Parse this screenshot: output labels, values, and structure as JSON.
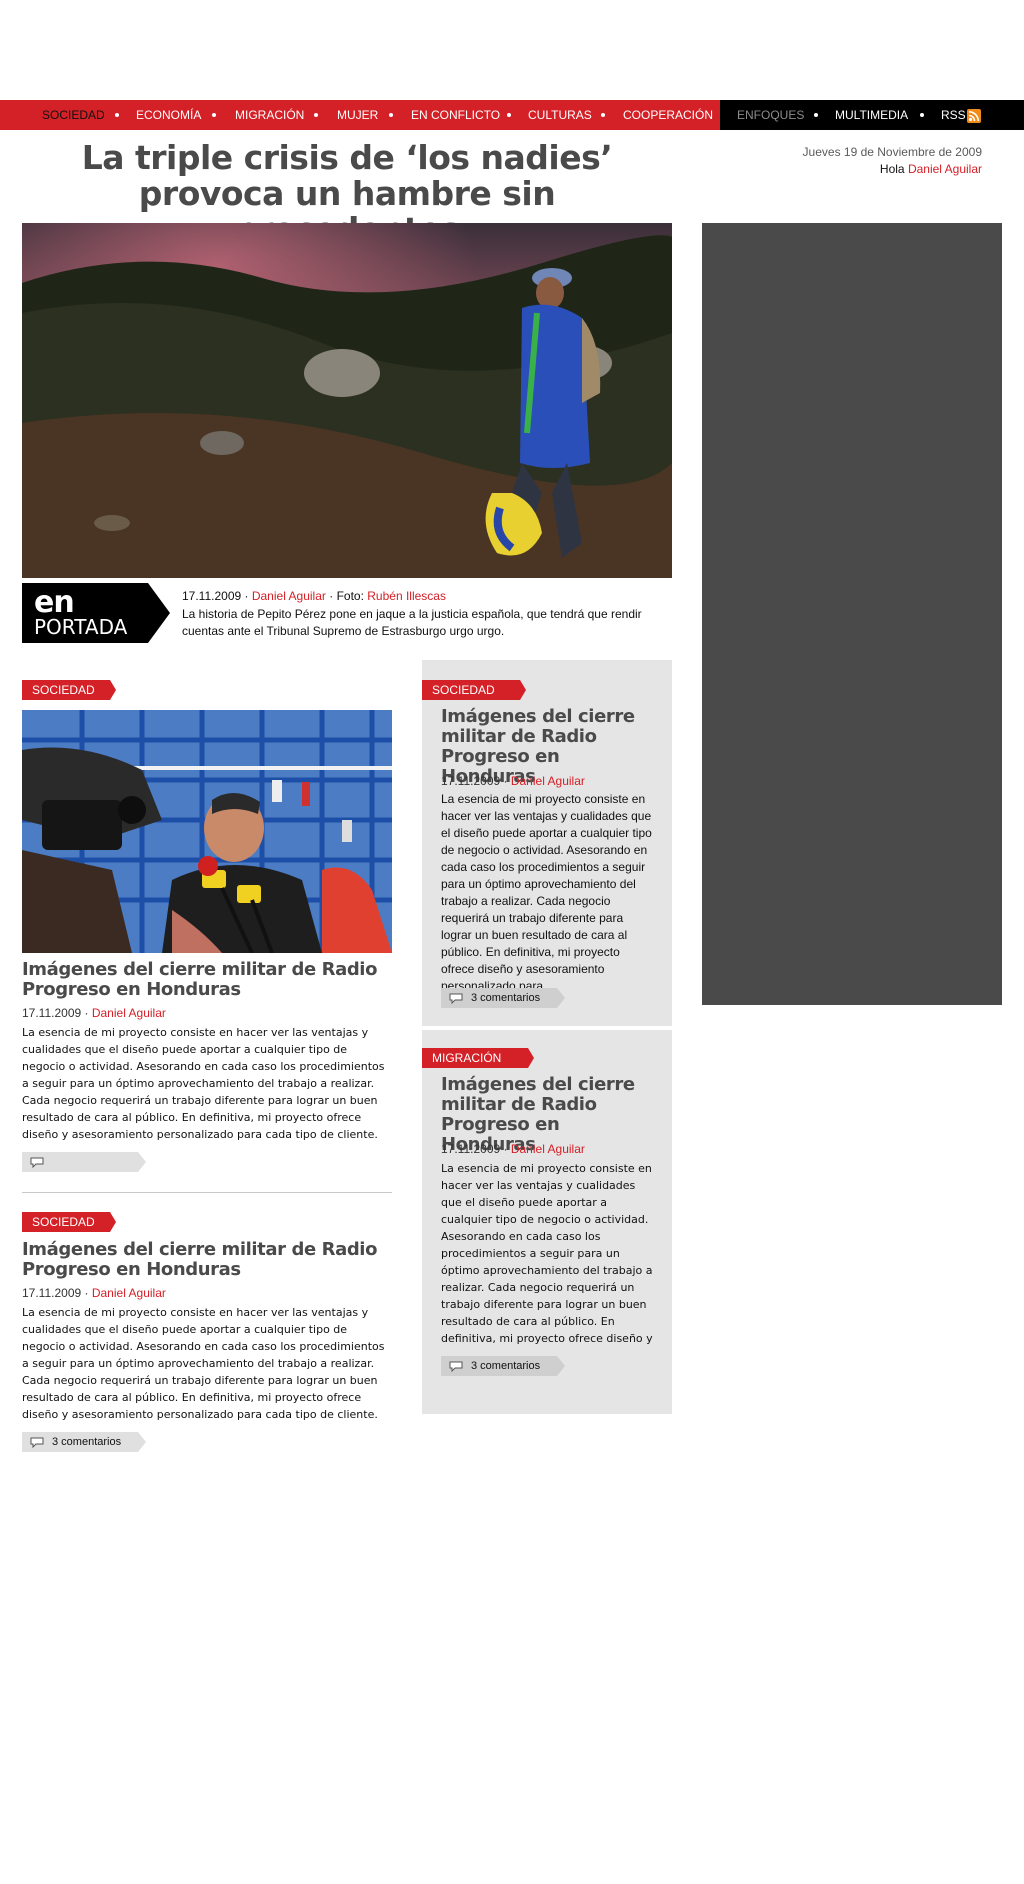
{
  "nav": {
    "items": [
      "SOCIEDAD",
      "ECONOMÍA",
      "MIGRACIÓN",
      "MUJER",
      "EN CONFLICTO",
      "CULTURAS",
      "COOPERACIÓN"
    ],
    "secondary": [
      "ENFOQUES",
      "MULTIMEDIA",
      "RSS"
    ]
  },
  "header": {
    "headline": "La triple crisis de ‘los nadies’ provoca un hambre sin precedentes",
    "date": "Jueves 19 de Noviembre de 2009",
    "greeting": "Hola",
    "user": "Daniel Aguilar"
  },
  "hero": {
    "badge_en": "en",
    "badge_portada": "PORTADA",
    "date": "17.11.2009",
    "author": "Daniel Aguilar",
    "photo_label": "· Foto:",
    "photographer": "Rubén Illescas",
    "text": "La historia de Pepito Pérez pone en jaque a la justicia española, que tendrá que rendir cuentas ante el Tribunal Supremo de Estrasburgo urgo urgo."
  },
  "articles": [
    {
      "category": "SOCIEDAD",
      "title": "Imágenes del cierre militar de Radio Progreso en Honduras",
      "date": "17.11.2009",
      "author": "Daniel Aguilar",
      "body": "La esencia de mi proyecto consiste en hacer ver las ventajas y cualidades que el diseño puede aportar a cualquier tipo de negocio o actividad. Asesorando en cada caso los procedimientos a seguir para un óptimo aprovechamiento del trabajo a realizar. Cada negocio requerirá un trabajo diferente para lograr un buen resultado de cara al público. En definitiva, mi proyecto ofrece diseño y asesoramiento personalizado para cada tipo de cliente.",
      "comments": ""
    },
    {
      "category": "SOCIEDAD",
      "title": "Imágenes del cierre militar de Radio Progreso en Honduras",
      "date": "17.11.2009",
      "author": "Daniel Aguilar",
      "body": "La esencia de mi proyecto consiste en hacer ver las ventajas y cualidades que el diseño puede aportar a cualquier tipo de negocio o actividad. Asesorando en cada caso los procedimientos a seguir para un óptimo aprovechamiento del trabajo a realizar. Cada negocio requerirá un trabajo diferente para lograr un buen resultado de cara al público. En definitiva, mi proyecto ofrece diseño y asesoramiento personalizado para cada tipo de cliente.",
      "comments": "3 comentarios"
    },
    {
      "category": "SOCIEDAD",
      "title": "Imágenes del cierre militar de Radio Progreso en Honduras",
      "date": "17.11.2009",
      "author": "Daniel Aguilar",
      "body": "La esencia de mi proyecto consiste en hacer ver las ventajas y cualidades que el diseño puede aportar a cualquier tipo de negocio o  actividad. Asesorando en cada caso los procedimientos a seguir para un óptimo aprovechamiento del trabajo a realizar. Cada negocio requerirá un trabajo diferente para lograr un buen resultado de cara al público. En definitiva, mi proyecto ofrece diseño y asesoramiento personalizado para",
      "comments": "3 comentarios"
    },
    {
      "category": "MIGRACIÓN",
      "title": "Imágenes del cierre militar de Radio Progreso en Honduras",
      "date": "17.11.2009",
      "author": "Daniel Aguilar",
      "body": "La esencia de mi proyecto consiste en hacer ver las ventajas y cualidades que el diseño puede aportar a cualquier tipo de negocio o  actividad. Asesorando en cada caso los procedimientos a seguir para un óptimo aprovechamiento del trabajo a realizar. Cada negocio requerirá un trabajo diferente para lograr un buen resultado de cara al público. En definitiva, mi proyecto ofrece diseño y asesoramiento",
      "comments": "3 comentarios"
    }
  ],
  "colors": {
    "accent": "#d42027",
    "nav_dark": "#000000",
    "sidebar": "#4a4a4a",
    "column_bg": "#e5e5e5",
    "headline": "#4a4a4a"
  },
  "icons": [
    "rss-icon",
    "comment-icon"
  ]
}
